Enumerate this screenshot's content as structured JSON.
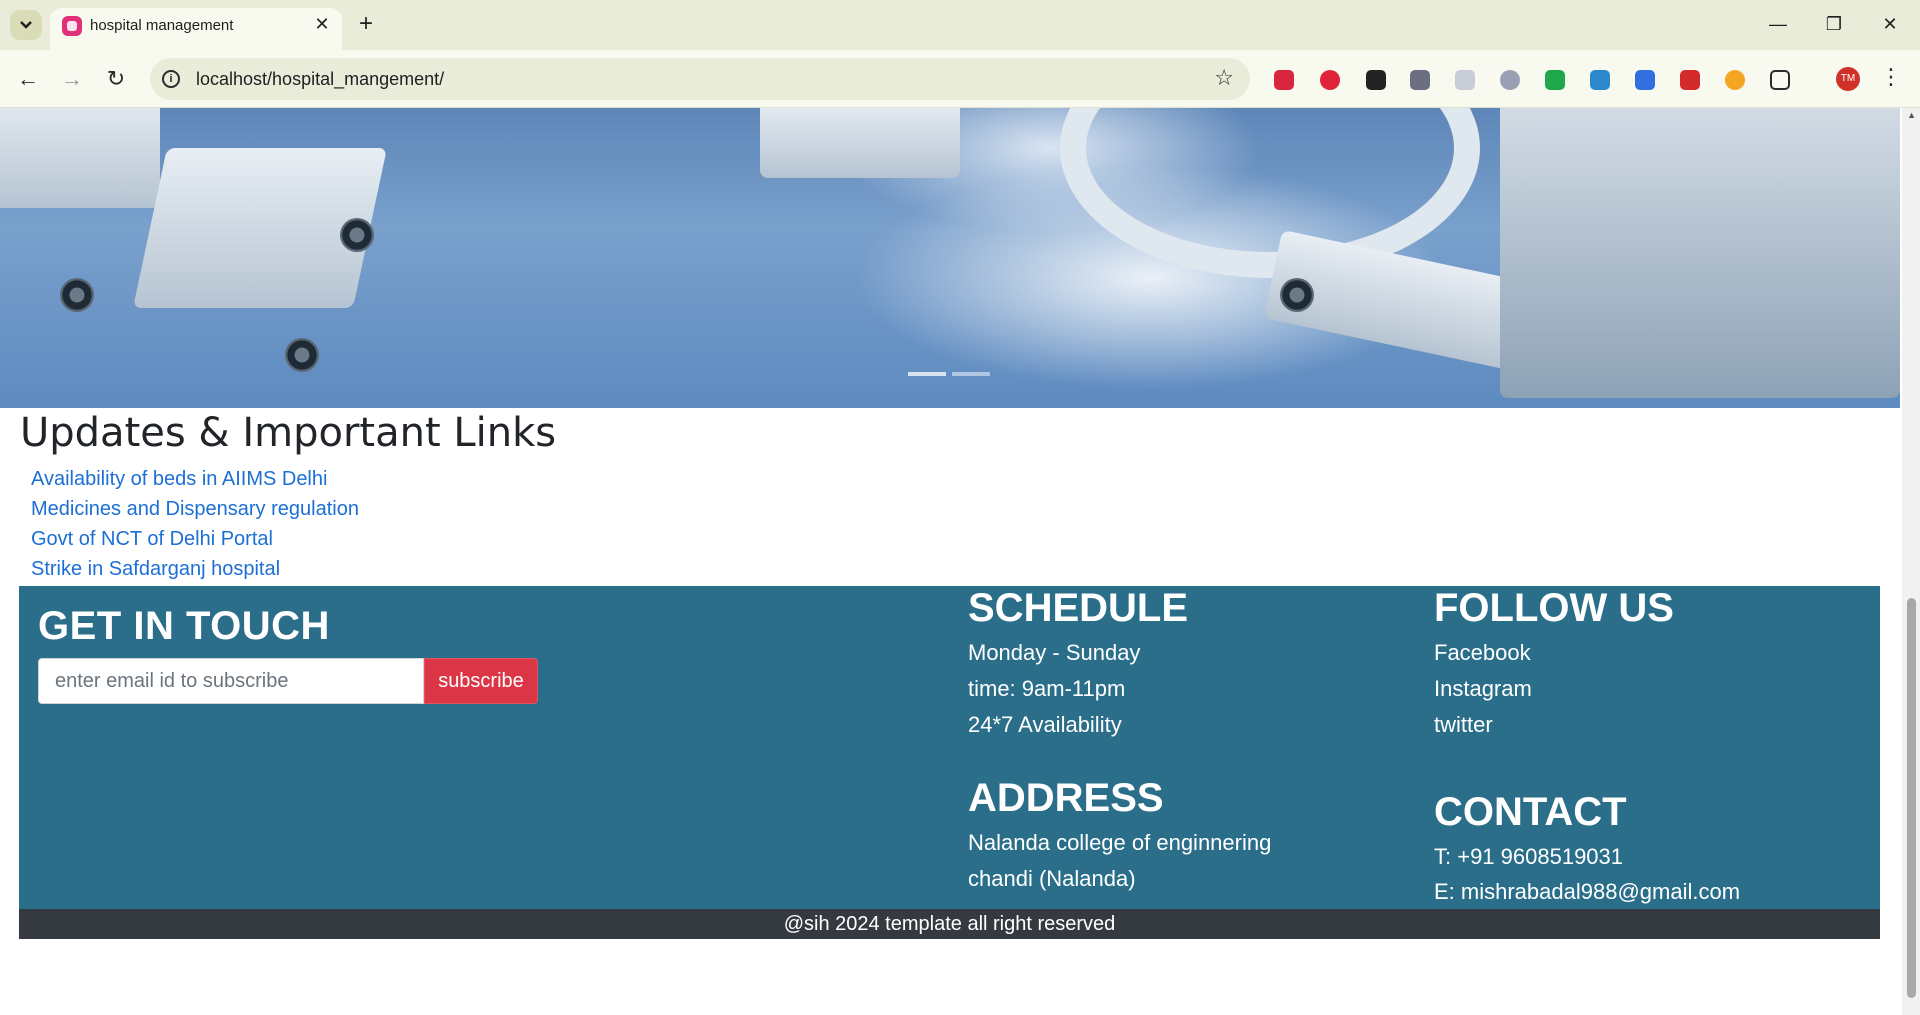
{
  "browser": {
    "tab_title": "hospital management",
    "url": "localhost/hospital_mangement/"
  },
  "updates": {
    "title": "Updates & Important Links",
    "links": [
      "Availability of beds in AIIMS Delhi",
      "Medicines and Dispensary regulation",
      "Govt of NCT of Delhi Portal",
      "Strike in Safdarganj hospital"
    ]
  },
  "footer": {
    "get_in_touch": "GET IN TOUCH",
    "email_placeholder": "enter email id to subscribe",
    "subscribe_label": "subscribe",
    "schedule": {
      "title": "SCHEDULE",
      "items": [
        "Monday - Sunday",
        "time: 9am-11pm",
        "24*7 Availability"
      ]
    },
    "follow": {
      "title": "FOLLOW US",
      "items": [
        "Facebook",
        "Instagram",
        "twitter"
      ]
    },
    "address": {
      "title": "ADDRESS",
      "items": [
        "Nalanda college of enginnering",
        "chandi (Nalanda)"
      ]
    },
    "contact": {
      "title": "CONTACT",
      "items": [
        "T: +91 9608519031",
        "E: mishrabadal988@gmail.com"
      ]
    },
    "copyright": "@sih 2024 template all right reserved"
  },
  "colors": {
    "footer_bg": "#2a6e8a",
    "subscribe_button": "#dc3545",
    "link": "#1c6fd4",
    "copyright_bg": "#343a40"
  }
}
